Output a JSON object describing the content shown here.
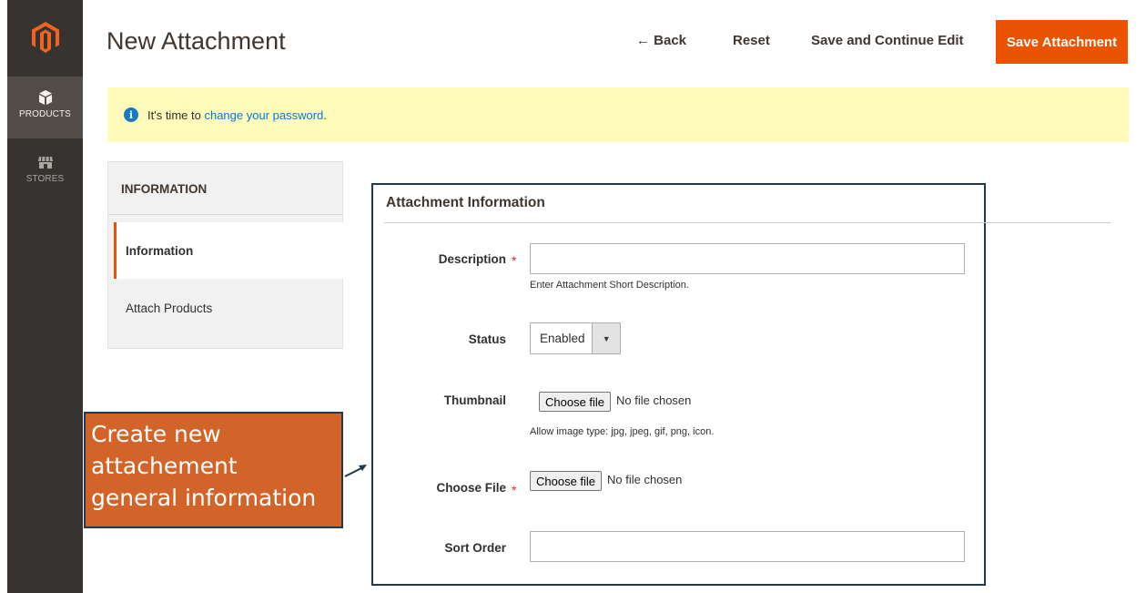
{
  "header": {
    "title": "New Attachment",
    "back_label": "← Back",
    "reset_label": "Reset",
    "save_continue_label": "Save and Continue Edit",
    "save_label": "Save Attachment"
  },
  "sidebar": {
    "items": [
      {
        "label": "PRODUCTS",
        "icon": "box-icon",
        "active": true
      },
      {
        "label": "STORES",
        "icon": "store-icon",
        "active": false
      }
    ]
  },
  "notice": {
    "prefix": "It's time to",
    "link": "change your password",
    "suffix": "."
  },
  "tabs": {
    "title": "INFORMATION",
    "items": [
      {
        "label": "Information",
        "active": true
      },
      {
        "label": "Attach Products",
        "active": false
      }
    ]
  },
  "form": {
    "section_title": "Attachment Information",
    "description": {
      "label": "Description",
      "value": "",
      "hint": "Enter Attachment Short Description."
    },
    "status": {
      "label": "Status",
      "value": "Enabled"
    },
    "thumbnail": {
      "label": "Thumbnail",
      "button": "Choose file",
      "status": "No file chosen",
      "hint": "Allow image type: jpg, jpeg, gif, png, icon."
    },
    "file": {
      "label": "Choose File",
      "button": "Choose file",
      "status": "No file chosen"
    },
    "sort_order": {
      "label": "Sort Order",
      "value": ""
    }
  },
  "callout": {
    "lines": [
      "Create new",
      "attachement",
      "general information"
    ]
  },
  "colors": {
    "accent": "#eb5202",
    "sidebar": "#373330",
    "notice_bg": "#fffbbb",
    "callout_bg": "#d2642a",
    "frame": "#1f3a4b",
    "link": "#007bdb"
  }
}
